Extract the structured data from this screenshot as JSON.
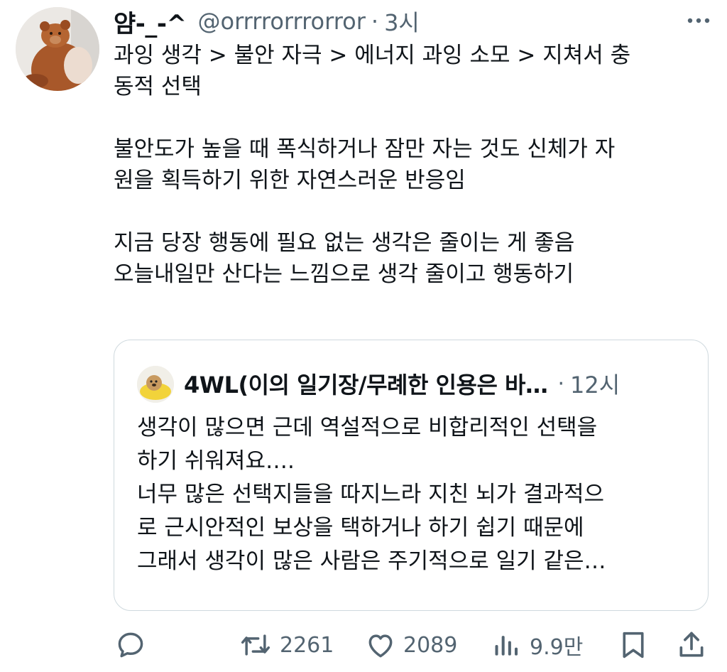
{
  "tweet": {
    "display_name": "얌-_-^",
    "handle": "@orrrrorrrorror",
    "separator": "·",
    "time": "3시",
    "more_icon": "more-horizontal-icon",
    "text_lines": [
      "과잉 생각 > 불안 자극 > 에너지 과잉 소모 > 지쳐서 충",
      "동적 선택",
      "",
      "불안도가 높을 때 폭식하거나 잠만 자는 것도 신체가 자",
      "원을 획득하기 위한 자연스러운 반응임",
      "",
      "지금 당장 행동에 필요 없는 생각은 줄이는 게 좋음",
      "오늘내일만 산다는 느낌으로 생각 줄이고 행동하기"
    ]
  },
  "quote": {
    "display_name": "4WL(이의 일기장/무례한 인용은 바…",
    "separator": "·",
    "time": "12시",
    "text_lines": [
      "생각이 많으면 근데 역설적으로 비합리적인 선택을",
      "하기 쉬워져요….",
      "너무 많은 선택지들을 따지느라 지친 뇌가 결과적으",
      "로 근시안적인 보상을 택하거나 하기 쉽기 때문에",
      "그래서 생각이 많은 사람은 주기적으로 일기 같은…"
    ]
  },
  "actions": {
    "reply_icon": "reply-icon",
    "retweet_icon": "retweet-icon",
    "retweet_count": "2261",
    "like_icon": "heart-icon",
    "like_count": "2089",
    "views_icon": "views-icon",
    "views_count": "9.9만",
    "bookmark_icon": "bookmark-icon",
    "share_icon": "share-icon"
  },
  "colors": {
    "text": "#0f1419",
    "secondary": "#536471",
    "border": "#cfd9de"
  }
}
